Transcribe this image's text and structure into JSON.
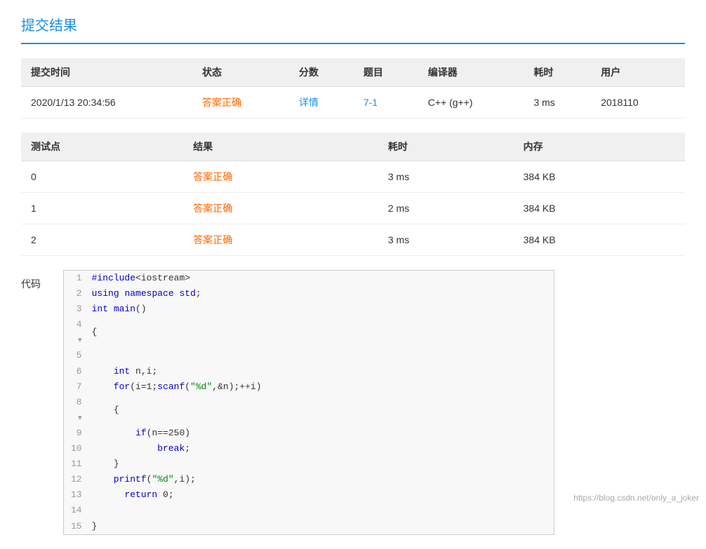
{
  "page": {
    "title": "提交结果"
  },
  "submission_table": {
    "headers": [
      "提交时间",
      "状态",
      "分数",
      "题目",
      "编译器",
      "耗时",
      "用户"
    ],
    "row": {
      "time": "2020/1/13 20:34:56",
      "status": "答案正确",
      "score": "详情",
      "problem": "7-1",
      "compiler": "C++ (g++)",
      "time_cost": "3 ms",
      "user": "2018110"
    }
  },
  "testpoint_table": {
    "headers": [
      "测试点",
      "结果",
      "耗时",
      "内存"
    ],
    "rows": [
      {
        "id": "0",
        "result": "答案正确",
        "time": "3 ms",
        "memory": "384 KB"
      },
      {
        "id": "1",
        "result": "答案正确",
        "time": "2 ms",
        "memory": "384 KB"
      },
      {
        "id": "2",
        "result": "答案正确",
        "time": "3 ms",
        "memory": "384 KB"
      }
    ]
  },
  "code_section": {
    "label": "代码",
    "lines": [
      {
        "num": "1",
        "code": "#include<iostream>"
      },
      {
        "num": "2",
        "code": "using namespace std;"
      },
      {
        "num": "3",
        "code": "int main()"
      },
      {
        "num": "4",
        "code": "{",
        "fold": true
      },
      {
        "num": "5",
        "code": ""
      },
      {
        "num": "6",
        "code": "    int n,i;"
      },
      {
        "num": "7",
        "code": "    for(i=1;scanf(\"%d\",&n);++i)"
      },
      {
        "num": "8",
        "code": "    {",
        "fold": true
      },
      {
        "num": "9",
        "code": "        if(n==250)"
      },
      {
        "num": "10",
        "code": "            break;"
      },
      {
        "num": "11",
        "code": "    }"
      },
      {
        "num": "12",
        "code": "    printf(\"%d\",i);"
      },
      {
        "num": "13",
        "code": "      return 0;"
      },
      {
        "num": "14",
        "code": ""
      },
      {
        "num": "15",
        "code": "}"
      }
    ]
  },
  "watermark": "https://blog.csdn.net/only_a_joker"
}
